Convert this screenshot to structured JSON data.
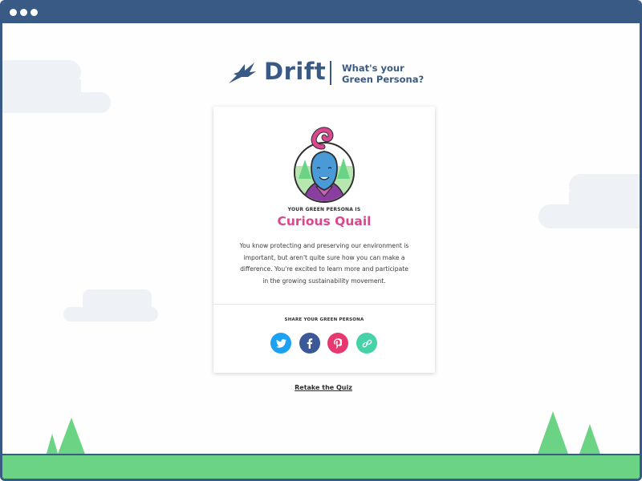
{
  "window": {
    "controls": [
      "dot",
      "dot",
      "dot"
    ]
  },
  "header": {
    "brand": "Drift",
    "tagline_line1": "What's your",
    "tagline_line2": "Green Persona?"
  },
  "card": {
    "kicker": "YOUR GREEN PERSONA IS",
    "persona_name": "Curious Quail",
    "description": "You know protecting and preserving our environment is important, but aren't quite sure how you can make a difference. You're excited to learn more and participate in the growing sustainability movement.",
    "share_title": "SHARE YOUR GREEN PERSONA",
    "share_buttons": [
      {
        "icon": "twitter-icon",
        "color": "#1da1f2"
      },
      {
        "icon": "facebook-icon",
        "color": "#3b5998"
      },
      {
        "icon": "pinterest-icon",
        "color": "#e6396f"
      },
      {
        "icon": "link-icon",
        "color": "#45d2a8"
      }
    ]
  },
  "retake_link": "Retake the Quiz",
  "colors": {
    "brand": "#3a5a86",
    "accent": "#d8478f",
    "ground": "#6bd484",
    "cloud": "#eef2f6"
  }
}
